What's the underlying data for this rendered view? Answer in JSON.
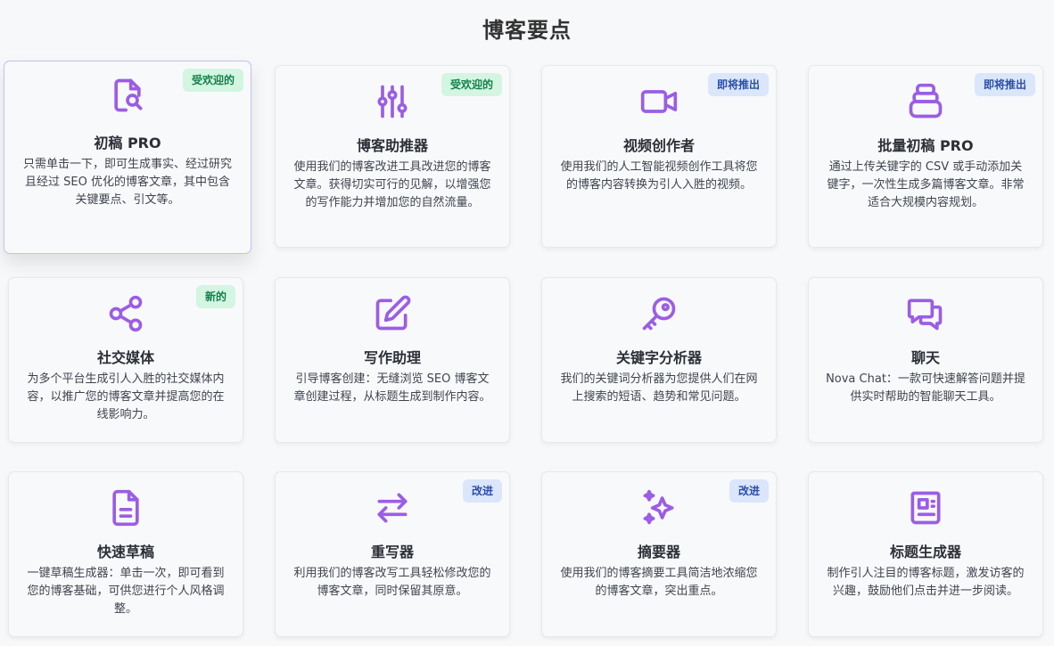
{
  "header": {
    "title": "博客要点"
  },
  "colors": {
    "accent": "#9b5de5",
    "badge_green_bg": "#d3f5e1",
    "badge_blue_bg": "#dbe6fb"
  },
  "cards": [
    {
      "title": "初稿 PRO",
      "badge": "受欢迎的",
      "icon": "document-search-icon",
      "desc": "只需单击一下，即可生成事实、经过研究且经过 SEO 优化的博客文章，其中包含关键要点、引文等。"
    },
    {
      "title": "博客助推器",
      "badge": "受欢迎的",
      "icon": "sliders-icon",
      "desc": "使用我们的博客改进工具改进您的博客文章。获得切实可行的见解，以增强您的写作能力并增加您的自然流量。"
    },
    {
      "title": "视频创作者",
      "badge": "即将推出",
      "icon": "video-camera-icon",
      "desc": "使用我们的人工智能视频创作工具将您的博客内容转换为引人入胜的视频。"
    },
    {
      "title": "批量初稿 PRO",
      "badge": "即将推出",
      "icon": "stack-icon",
      "desc": "通过上传关键字的 CSV 或手动添加关键字，一次性生成多篇博客文章。非常适合大规模内容规划。"
    },
    {
      "title": "社交媒体",
      "badge": "新的",
      "icon": "share-icon",
      "desc": "为多个平台生成引人入胜的社交媒体内容，以推广您的博客文章并提高您的在线影响力。"
    },
    {
      "title": "写作助理",
      "badge": "",
      "icon": "edit-icon",
      "desc": "引导博客创建：无缝浏览 SEO 博客文章创建过程，从标题生成到制作内容。"
    },
    {
      "title": "关键字分析器",
      "badge": "",
      "icon": "key-icon",
      "desc": "我们的关键词分析器为您提供人们在网上搜索的短语、趋势和常见问题。"
    },
    {
      "title": "聊天",
      "badge": "",
      "icon": "chat-bubbles-icon",
      "desc": "Nova Chat：一款可快速解答问题并提供实时帮助的智能聊天工具。"
    },
    {
      "title": "快速草稿",
      "badge": "",
      "icon": "document-text-icon",
      "desc": "一键草稿生成器：单击一次，即可看到您的博客基础，可供您进行个人风格调整。"
    },
    {
      "title": "重写器",
      "badge": "改进",
      "icon": "arrows-swap-icon",
      "desc": "利用我们的博客改写工具轻松修改您的博客文章，同时保留其原意。"
    },
    {
      "title": "摘要器",
      "badge": "改进",
      "icon": "sparkles-icon",
      "desc": "使用我们的博客摘要工具简洁地浓缩您的博客文章，突出重点。"
    },
    {
      "title": "标题生成器",
      "badge": "",
      "icon": "newspaper-icon",
      "desc": "制作引人注目的博客标题，激发访客的兴趣，鼓励他们点击并进一步阅读。"
    }
  ]
}
